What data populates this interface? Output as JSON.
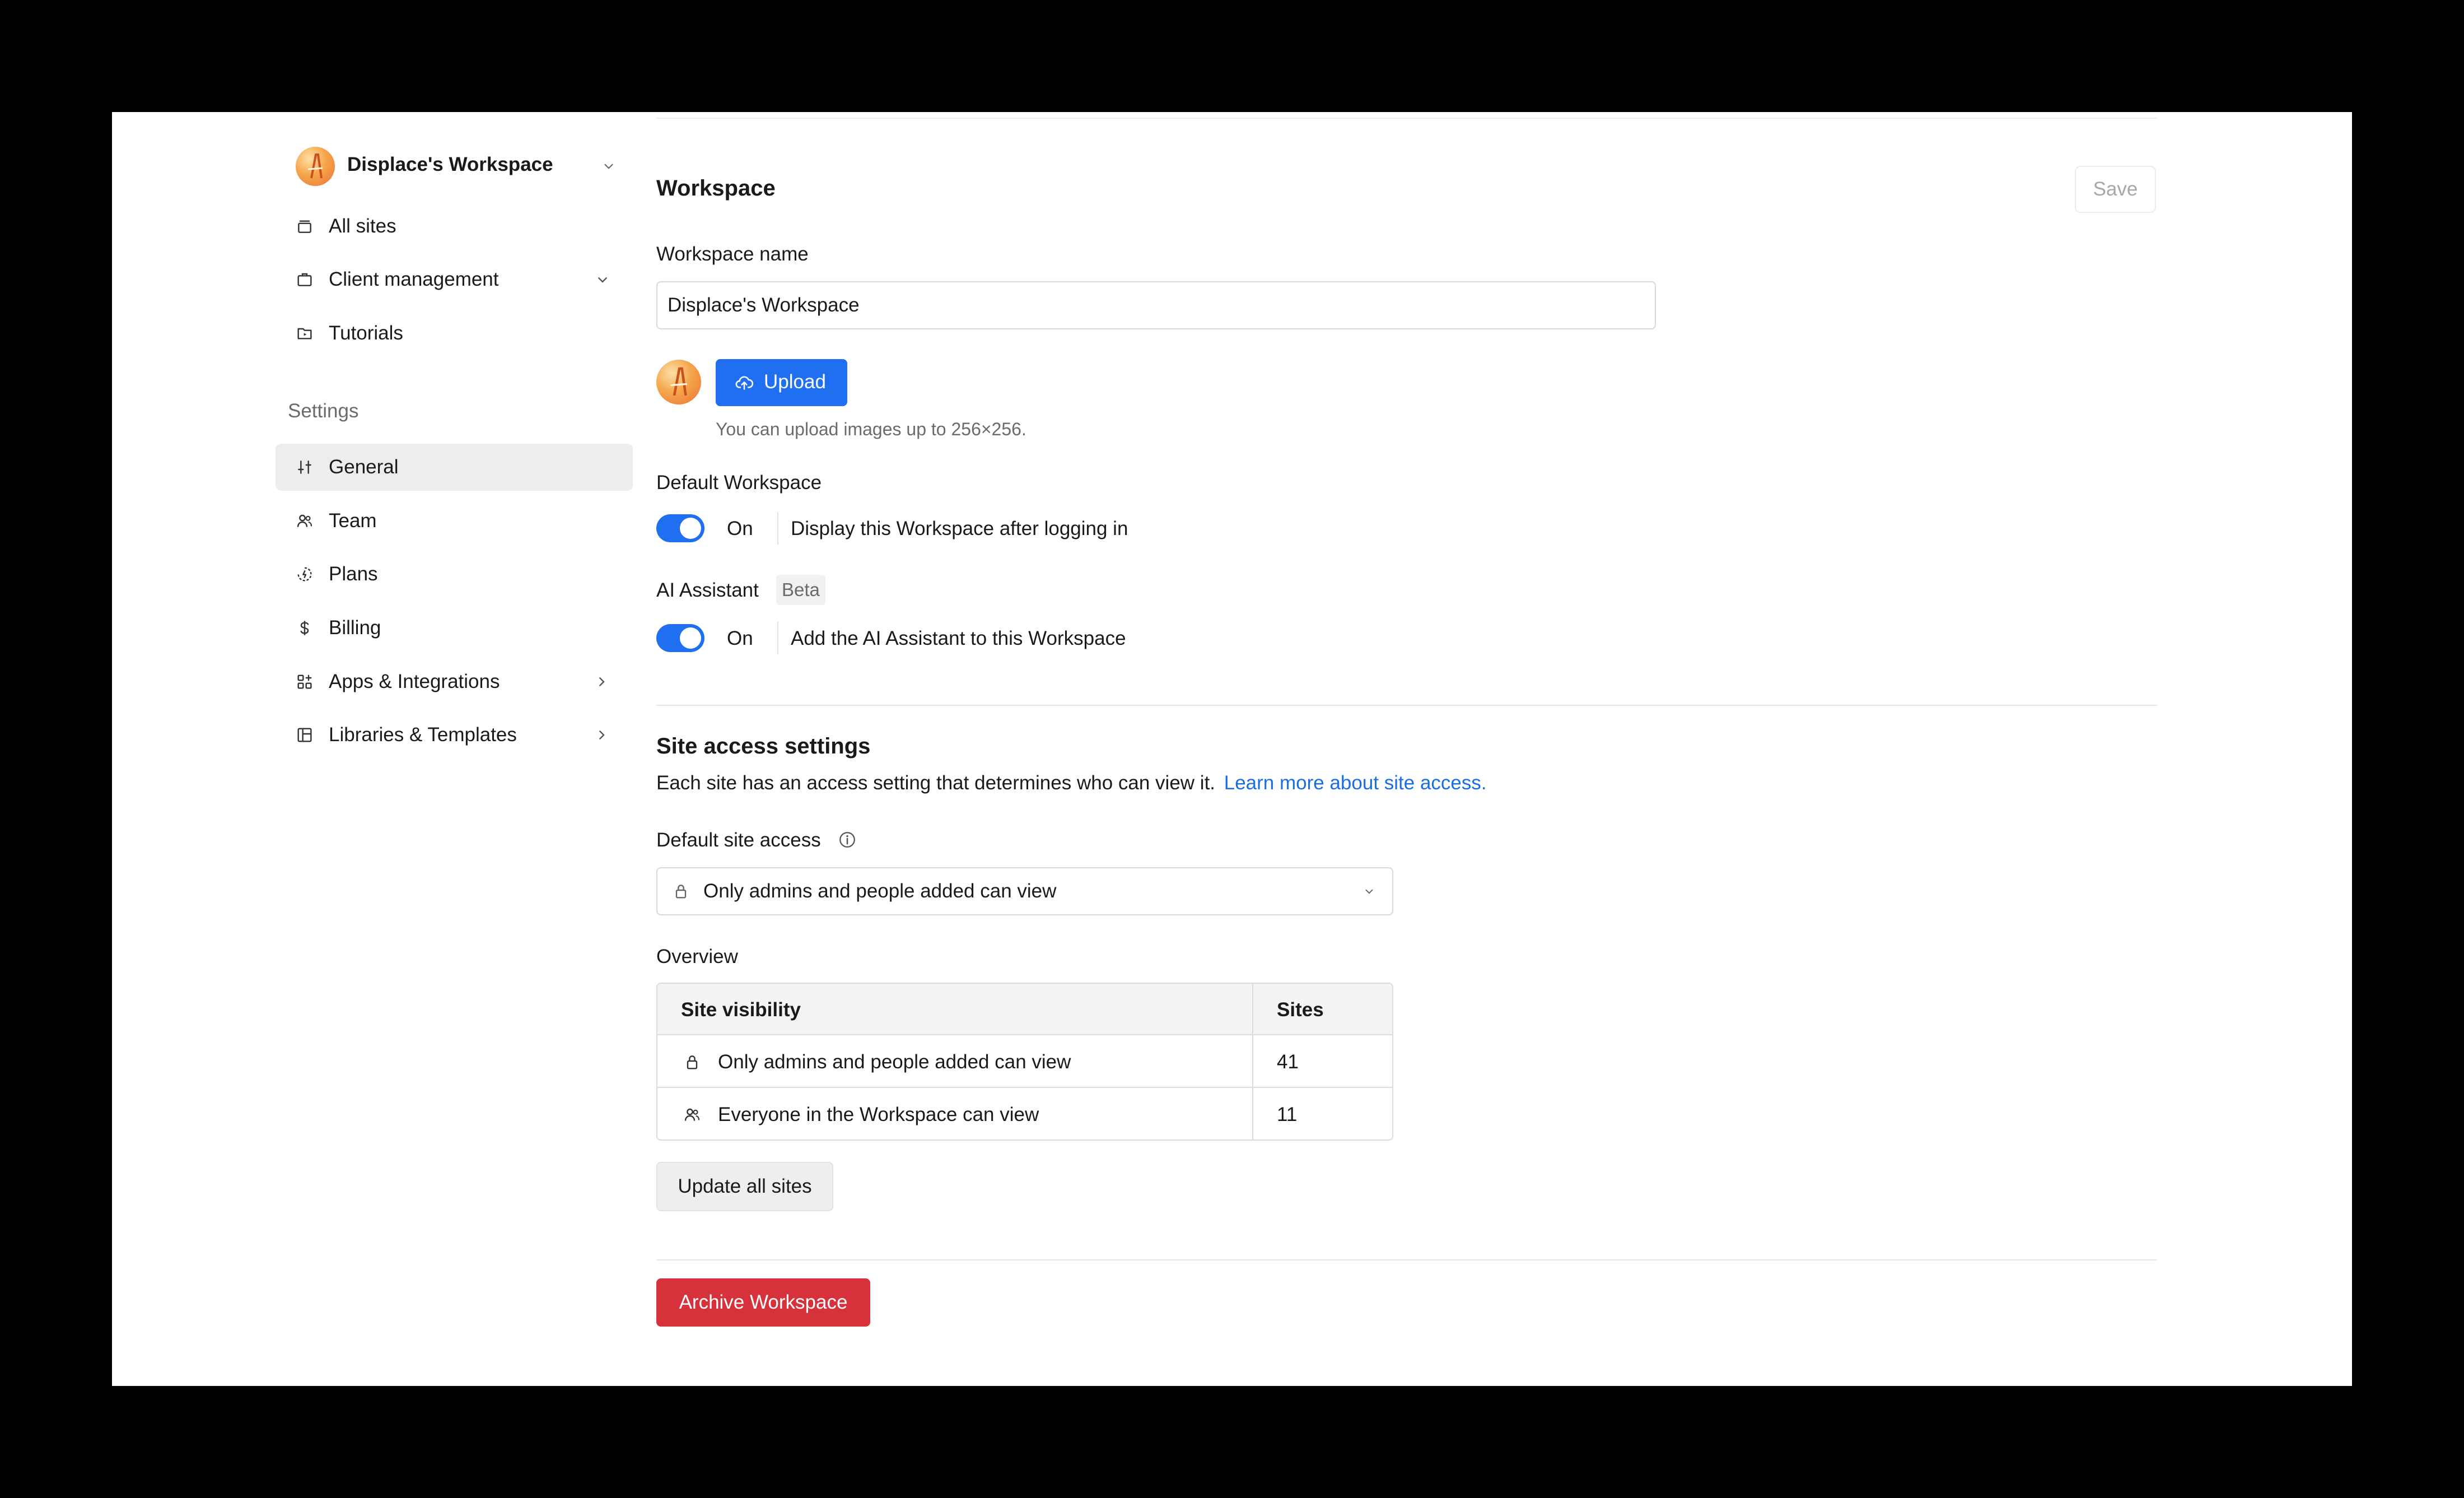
{
  "workspace_switcher": {
    "name": "Displace's Workspace"
  },
  "nav": {
    "all_sites": "All sites",
    "client_management": "Client management",
    "tutorials": "Tutorials"
  },
  "settings": {
    "heading": "Settings",
    "items": [
      {
        "label": "General",
        "icon": "sliders-icon",
        "active": true
      },
      {
        "label": "Team",
        "icon": "users-icon"
      },
      {
        "label": "Plans",
        "icon": "plans-icon"
      },
      {
        "label": "Billing",
        "icon": "dollar-icon"
      },
      {
        "label": "Apps & Integrations",
        "icon": "apps-icon"
      },
      {
        "label": "Libraries & Templates",
        "icon": "library-icon"
      }
    ]
  },
  "workspace": {
    "title": "Workspace",
    "save_label": "Save",
    "name_label": "Workspace name",
    "name_value": "Displace's Workspace",
    "upload_label": "Upload",
    "upload_hint": "You can upload images up to 256×256.",
    "default_label": "Default Workspace",
    "default_state": "On",
    "default_desc": "Display this Workspace after logging in",
    "ai_label": "AI Assistant",
    "ai_badge": "Beta",
    "ai_state": "On",
    "ai_desc": "Add the AI Assistant to this Workspace"
  },
  "site_access": {
    "title": "Site access settings",
    "description": "Each site has an access setting that determines who can view it.",
    "learn_more": "Learn more about site access.",
    "default_label": "Default site access",
    "default_value": "Only admins and people added can view",
    "overview_label": "Overview",
    "table": {
      "headers": [
        "Site visibility",
        "Sites"
      ],
      "rows": [
        {
          "visibility": "Only admins and people added can view",
          "sites": "41",
          "icon": "lock-icon"
        },
        {
          "visibility": "Everyone in the Workspace can view",
          "sites": "11",
          "icon": "users-icon"
        }
      ]
    },
    "update_all_label": "Update all sites"
  },
  "archive_label": "Archive Workspace",
  "colors": {
    "accent": "#1f6ff0",
    "danger": "#d7313c",
    "link": "#1a6fe0",
    "active_bg": "#ededed"
  }
}
